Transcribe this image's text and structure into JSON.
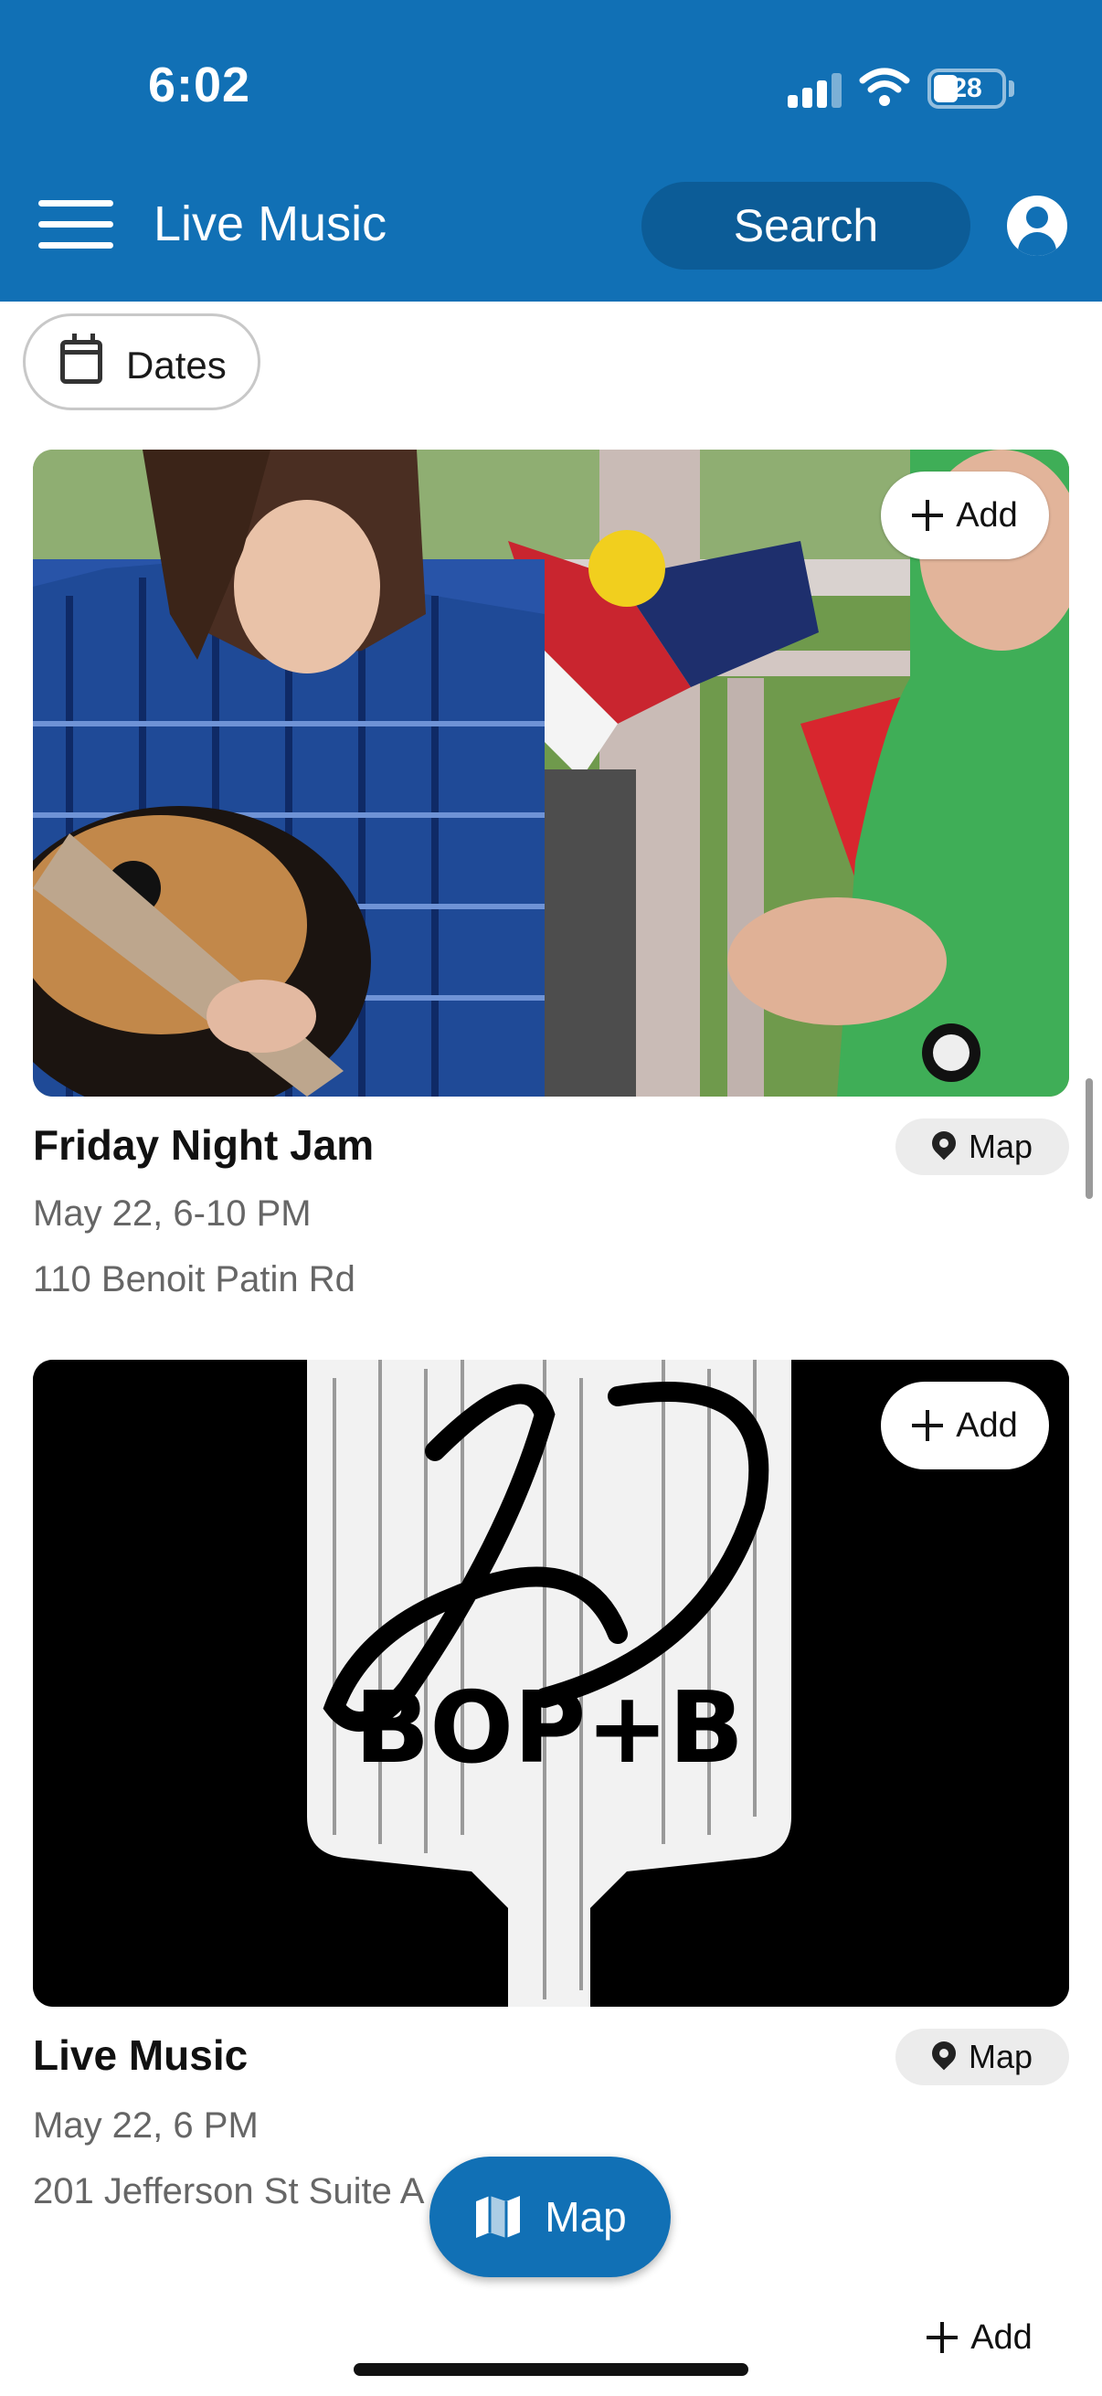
{
  "status_bar": {
    "time": "6:02",
    "battery": "28"
  },
  "header": {
    "title": "Live Music",
    "search_label": "Search"
  },
  "filters": {
    "dates_label": "Dates"
  },
  "events": [
    {
      "title": "Friday Night Jam",
      "date": "May 22, 6-10 PM",
      "address": "110 Benoit Patin Rd",
      "add_label": "Add",
      "map_label": "Map"
    },
    {
      "title": "Live Music",
      "date": "May 22, 6 PM",
      "address": "201 Jefferson St Suite A",
      "add_label": "Add",
      "map_label": "Map",
      "logo_text": "BOP+B"
    },
    {
      "add_label": "Add"
    }
  ],
  "floating": {
    "map_label": "Map"
  },
  "colors": {
    "brand_blue": "#1170b5",
    "search_blue": "#0c5c97"
  }
}
